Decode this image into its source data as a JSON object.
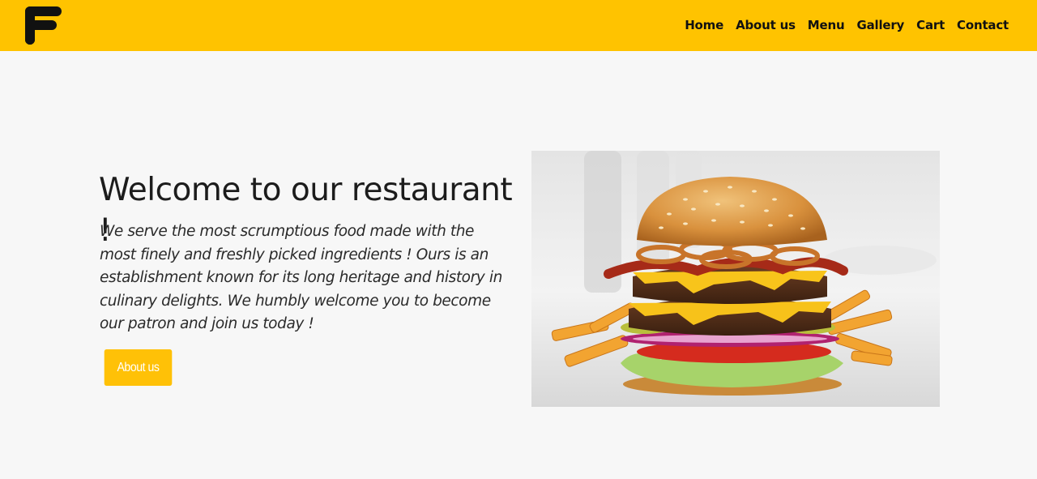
{
  "nav": {
    "logo_icon": "letter-f-logo",
    "items": [
      {
        "label": "Home"
      },
      {
        "label": "About us"
      },
      {
        "label": "Menu"
      },
      {
        "label": "Gallery"
      },
      {
        "label": "Cart"
      },
      {
        "label": "Contact"
      }
    ],
    "bg_color": "#ffc300"
  },
  "hero": {
    "title": "Welcome to our restaurant !",
    "text": "We serve the most scrumptious food made with the most finely and freshly picked ingredients ! Ours is an establishment known for its long heritage and history in culinary delights. We humbly welcome you to become our patron and join us today !",
    "button_label": "About us",
    "button_color": "#ffc107",
    "image": "burger-with-fries-photo"
  }
}
